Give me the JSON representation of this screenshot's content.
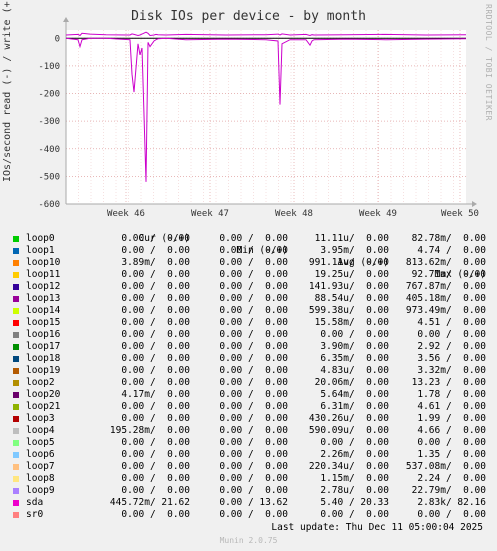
{
  "chart_data": {
    "type": "line",
    "title": "Disk IOs per device - by month",
    "ylabel": "IOs/second read (-) / write (+)",
    "ylim": [
      -600,
      30
    ],
    "yticks": [
      0,
      -100,
      -200,
      -300,
      -400,
      -500,
      -600
    ],
    "x_ticks": [
      "Week 46",
      "Week 47",
      "Week 48",
      "Week 49",
      "Week 50"
    ],
    "grid": true,
    "series": [
      {
        "name": "sda",
        "color": "#cc00cc",
        "x": [
          0,
          0.03,
          0.035,
          0.04,
          0.06,
          0.1,
          0.16,
          0.165,
          0.17,
          0.18,
          0.185,
          0.19,
          0.2,
          0.205,
          0.21,
          0.22,
          0.225,
          0.23,
          0.25,
          0.3,
          0.4,
          0.5,
          0.53,
          0.535,
          0.54,
          0.56,
          0.6,
          0.61,
          0.615,
          0.62,
          0.7,
          0.8,
          0.9,
          1.0
        ],
        "write": [
          12,
          14,
          10,
          18,
          15,
          13,
          12,
          16,
          14,
          10,
          12,
          15,
          22,
          18,
          10,
          12,
          14,
          13,
          12,
          14,
          12,
          13,
          15,
          12,
          16,
          12,
          14,
          10,
          13,
          12,
          13,
          14,
          12,
          13
        ],
        "read": [
          0,
          -5,
          -30,
          -5,
          0,
          0,
          -5,
          -130,
          -195,
          -20,
          -60,
          -35,
          -520,
          -15,
          -30,
          -10,
          -5,
          -2,
          0,
          -5,
          -3,
          -5,
          -10,
          -240,
          -20,
          -5,
          -5,
          -25,
          -10,
          -5,
          -3,
          -5,
          -3,
          -2
        ]
      }
    ]
  },
  "watermark": "RRDTOOL / TOBI OETIKER",
  "legend": {
    "headers": {
      "cur": "Cur (-/+)",
      "min": "Min (-/+)",
      "avg": "Avg (-/+)",
      "max": "Max (-/+)"
    },
    "rows": [
      {
        "name": "loop0",
        "color": "#00cc00",
        "cur": "0.00 /  0.00",
        "min": "0.00 /  0.00",
        "avg": "11.11u/  0.00",
        "max": "82.78m/  0.00"
      },
      {
        "name": "loop1",
        "color": "#0066b3",
        "cur": "0.00 /  0.00",
        "min": "0.00 /  0.00",
        "avg": "3.95m/  0.00",
        "max": "4.74 /  0.00"
      },
      {
        "name": "loop10",
        "color": "#ff8000",
        "cur": "3.89m/  0.00",
        "min": "0.00 /  0.00",
        "avg": "991.11u/  0.00",
        "max": "813.62m/  0.00"
      },
      {
        "name": "loop11",
        "color": "#ffcc00",
        "cur": "0.00 /  0.00",
        "min": "0.00 /  0.00",
        "avg": "19.25u/  0.00",
        "max": "92.71m/  0.00"
      },
      {
        "name": "loop12",
        "color": "#330099",
        "cur": "0.00 /  0.00",
        "min": "0.00 /  0.00",
        "avg": "141.93u/  0.00",
        "max": "767.87m/  0.00"
      },
      {
        "name": "loop13",
        "color": "#990099",
        "cur": "0.00 /  0.00",
        "min": "0.00 /  0.00",
        "avg": "88.54u/  0.00",
        "max": "405.18m/  0.00"
      },
      {
        "name": "loop14",
        "color": "#ccff00",
        "cur": "0.00 /  0.00",
        "min": "0.00 /  0.00",
        "avg": "599.38u/  0.00",
        "max": "973.49m/  0.00"
      },
      {
        "name": "loop15",
        "color": "#ff0000",
        "cur": "0.00 /  0.00",
        "min": "0.00 /  0.00",
        "avg": "15.58m/  0.00",
        "max": "4.51 /  0.00"
      },
      {
        "name": "loop16",
        "color": "#808080",
        "cur": "0.00 /  0.00",
        "min": "0.00 /  0.00",
        "avg": "0.00 /  0.00",
        "max": "0.00 /  0.00"
      },
      {
        "name": "loop17",
        "color": "#008f00",
        "cur": "0.00 /  0.00",
        "min": "0.00 /  0.00",
        "avg": "3.90m/  0.00",
        "max": "2.92 /  0.00"
      },
      {
        "name": "loop18",
        "color": "#00487d",
        "cur": "0.00 /  0.00",
        "min": "0.00 /  0.00",
        "avg": "6.35m/  0.00",
        "max": "3.56 /  0.00"
      },
      {
        "name": "loop19",
        "color": "#b35a00",
        "cur": "0.00 /  0.00",
        "min": "0.00 /  0.00",
        "avg": "4.83u/  0.00",
        "max": "3.32m/  0.00"
      },
      {
        "name": "loop2",
        "color": "#b38f00",
        "cur": "0.00 /  0.00",
        "min": "0.00 /  0.00",
        "avg": "20.06m/  0.00",
        "max": "13.23 /  0.00"
      },
      {
        "name": "loop20",
        "color": "#6b006b",
        "cur": "4.17m/  0.00",
        "min": "0.00 /  0.00",
        "avg": "5.64m/  0.00",
        "max": "1.78 /  0.00"
      },
      {
        "name": "loop21",
        "color": "#8fb300",
        "cur": "0.00 /  0.00",
        "min": "0.00 /  0.00",
        "avg": "6.31m/  0.00",
        "max": "4.61 /  0.00"
      },
      {
        "name": "loop3",
        "color": "#b30000",
        "cur": "0.00 /  0.00",
        "min": "0.00 /  0.00",
        "avg": "430.26u/  0.00",
        "max": "1.99 /  0.00"
      },
      {
        "name": "loop4",
        "color": "#bebebe",
        "cur": "195.28m/  0.00",
        "min": "0.00 /  0.00",
        "avg": "590.09u/  0.00",
        "max": "4.66 /  0.00"
      },
      {
        "name": "loop5",
        "color": "#80ff80",
        "cur": "0.00 /  0.00",
        "min": "0.00 /  0.00",
        "avg": "0.00 /  0.00",
        "max": "0.00 /  0.00"
      },
      {
        "name": "loop6",
        "color": "#80c9ff",
        "cur": "0.00 /  0.00",
        "min": "0.00 /  0.00",
        "avg": "2.26m/  0.00",
        "max": "1.35 /  0.00"
      },
      {
        "name": "loop7",
        "color": "#ffc080",
        "cur": "0.00 /  0.00",
        "min": "0.00 /  0.00",
        "avg": "220.34u/  0.00",
        "max": "537.08m/  0.00"
      },
      {
        "name": "loop8",
        "color": "#ffe680",
        "cur": "0.00 /  0.00",
        "min": "0.00 /  0.00",
        "avg": "1.15m/  0.00",
        "max": "2.24 /  0.00"
      },
      {
        "name": "loop9",
        "color": "#aa80ff",
        "cur": "0.00 /  0.00",
        "min": "0.00 /  0.00",
        "avg": "2.78u/  0.00",
        "max": "22.79m/  0.00"
      },
      {
        "name": "sda",
        "color": "#ee00cc",
        "cur": "445.72m/ 21.62",
        "min": "0.00 / 13.62",
        "avg": "5.40 / 20.33",
        "max": "2.83k/ 82.16"
      },
      {
        "name": "sr0",
        "color": "#ff8080",
        "cur": "0.00 /  0.00",
        "min": "0.00 /  0.00",
        "avg": "0.00 /  0.00",
        "max": "0.00 /  0.00"
      }
    ]
  },
  "last_update": "Last update: Thu Dec 11 05:00:04 2025",
  "footer": "Munin 2.0.75"
}
